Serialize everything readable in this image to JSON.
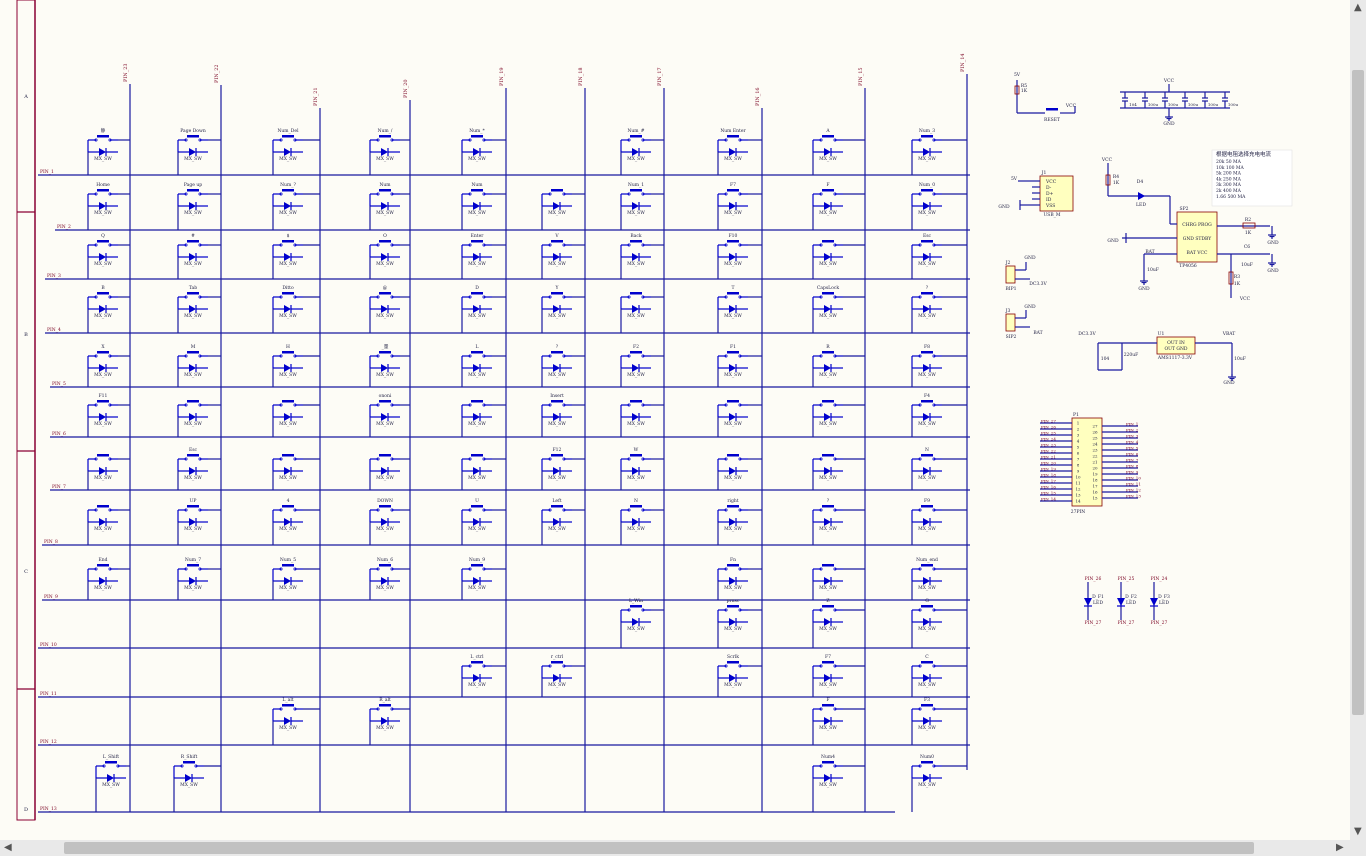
{
  "colors": {
    "wire": "#1a1aa0",
    "symbol": "#0000cc",
    "label": "#7a0020",
    "frame": "#8a0033",
    "text": "#222244",
    "ic_fill": "#ffffbf",
    "ic_stroke": "#880000"
  },
  "frame_labels": [
    "A",
    "B",
    "C",
    "D"
  ],
  "switch_part": "MX_SW",
  "cols": [
    "PIN_23",
    "PIN_22",
    "PIN_21",
    "PIN_20",
    "PIN_19",
    "PIN_18",
    "PIN_17",
    "PIN_16",
    "PIN_15",
    "PIN_14"
  ],
  "rows": [
    "PIN_1",
    "PIN_2",
    "PIN_3",
    "PIN_4",
    "PIN_5",
    "PIN_6",
    "PIN_7",
    "PIN_8",
    "PIN_9",
    "PIN_10",
    "PIN_11",
    "PIN_12",
    "PIN_13"
  ],
  "matrix": [
    [
      "静",
      "Page Down",
      "Num_Del",
      "Num_/",
      "Num_*",
      "",
      "Num_#",
      "Num Enter",
      "A",
      "Num_3"
    ],
    [
      "Home",
      "Page up",
      "Num_?",
      "Num",
      "Num",
      "",
      "Num_1",
      "F7",
      "F",
      "Num_0"
    ],
    [
      "Q",
      "#",
      "$",
      "O",
      "Enter",
      "V",
      "Back",
      "F10",
      "",
      "Esc"
    ],
    [
      "B",
      "Tab",
      "Ditto",
      "@",
      "D",
      "Y",
      "",
      "T",
      "CapsLock",
      "?"
    ],
    [
      "X",
      "M",
      "H",
      "_量",
      "L",
      "?",
      "F2",
      "F1",
      "R",
      "F8"
    ],
    [
      "F11",
      "",
      "",
      "ononi",
      "",
      "Insert",
      "",
      "",
      "",
      "F4"
    ],
    [
      "",
      "Esc",
      "",
      "",
      "",
      "F12",
      "W",
      "",
      "",
      "N"
    ],
    [
      "",
      "UP",
      "4",
      "DOWN",
      "U",
      "Left",
      "N",
      "right",
      "?",
      "F9"
    ],
    [
      "End",
      "Num_7",
      "Num_5",
      "Num_6",
      "Num_9",
      "",
      "",
      "Fn",
      "",
      "Num_end"
    ],
    [
      "",
      "",
      "",
      "",
      "",
      "",
      "L_Win",
      "prnsc",
      "Z",
      "G"
    ],
    [
      "",
      "",
      "",
      "",
      "L_ctrl",
      "r_ctrl",
      "",
      "Scrlk",
      "F7",
      "C"
    ],
    [
      "",
      "",
      "L_alt",
      "R_alt",
      "",
      "",
      "",
      "",
      "F",
      "F3"
    ],
    [
      "L_Shift",
      "R_Shift",
      "",
      "",
      "",
      "",
      "",
      "",
      "Num4",
      "Num0"
    ]
  ],
  "reset": {
    "label": "RESET",
    "vcc": "VCC",
    "r_ref": "R5",
    "r_val": "1K",
    "net": "5V"
  },
  "caps": {
    "vcc": "VCC",
    "gnd": "GND",
    "items": [
      "104",
      "100u",
      "100u",
      "100u",
      "100u",
      "100u"
    ]
  },
  "charge_table": {
    "title": "根据电阻选择充电电流",
    "rows": [
      "20k 50 MA",
      "10k 100 MA",
      "5k 200 MA",
      "4k 250 MA",
      "3k 300 MA",
      "2k 400 MA",
      "1.66 500 MA"
    ]
  },
  "usb": {
    "ref": "J1",
    "name": "USB_M",
    "pins": [
      "VCC",
      "D-",
      "D+",
      "ID",
      "VSS"
    ],
    "gnd": "GND",
    "net": "5V"
  },
  "charger": {
    "ref": "SP2",
    "name": "TP4056",
    "pins": [
      "CHRG PROG",
      "GND STDBY",
      "BAT  VCC"
    ],
    "vcc": "VCC",
    "r4": "R4",
    "r4v": "1K",
    "led": "D4",
    "led_name": "LED",
    "r2": "R2",
    "r2v": "1K",
    "r3": "R3",
    "r3v": "1K",
    "c": "C6",
    "cv": "10uF",
    "c2": "10uF",
    "bat": "BAT",
    "gnd": "GND"
  },
  "bip1": {
    "ref": "J2",
    "name": "BIP1",
    "net": "DC3.3V",
    "gnd": "GND"
  },
  "bip2": {
    "ref": "J3",
    "name": "SIP2",
    "net": "BAT",
    "gnd": "GND"
  },
  "ldo": {
    "ref": "U1",
    "name": "AMS1117-3.3V",
    "in_net": "DC3.3V",
    "out_net": "VBAT",
    "pins": [
      "OUT  IN",
      "OUT  GND"
    ],
    "c1": "104",
    "c2": "220uF",
    "c3": "10uF",
    "gnd": "GND"
  },
  "header": {
    "ref": "P1",
    "name": "27PIN",
    "left": [
      "PIN_27",
      "PIN_26",
      "PIN_25",
      "PIN_24",
      "PIN_23",
      "PIN_22",
      "PIN_21",
      "PIN_20",
      "PIN_19",
      "PIN_18",
      "PIN_17",
      "PIN_16",
      "PIN_15",
      "PIN_14"
    ],
    "right": [
      "PIN_1",
      "PIN_2",
      "PIN_3",
      "PIN_4",
      "PIN_5",
      "PIN_6",
      "PIN_7",
      "PIN_8",
      "PIN_9",
      "PIN_10",
      "PIN_11",
      "PIN_12",
      "PIN_13"
    ]
  },
  "leds": [
    {
      "top": "PIN_26",
      "ref": "D_F1",
      "name": "LED",
      "bot": "PIN_27"
    },
    {
      "top": "PIN_25",
      "ref": "D_F2",
      "name": "LED",
      "bot": "PIN_27"
    },
    {
      "top": "PIN_24",
      "ref": "D_F3",
      "name": "LED",
      "bot": "PIN_27"
    }
  ]
}
